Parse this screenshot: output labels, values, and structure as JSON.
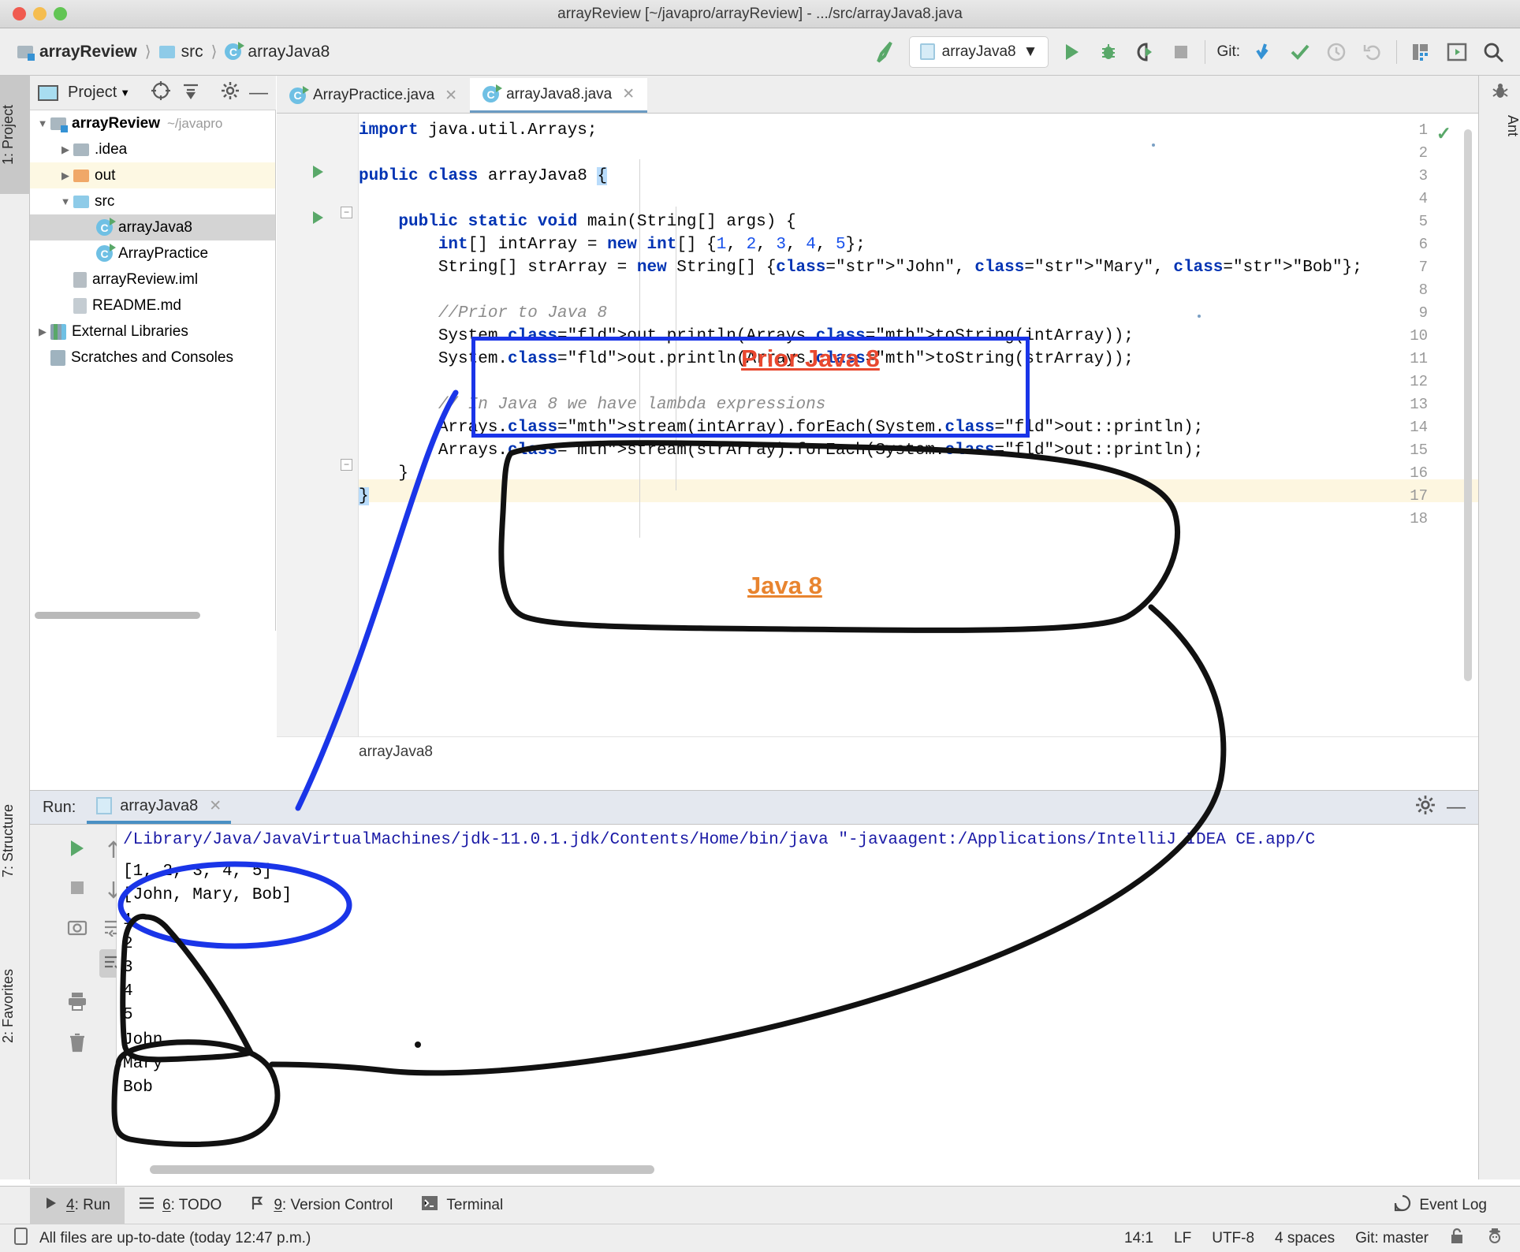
{
  "window": {
    "title": "arrayReview [~/javapro/arrayReview] - .../src/arrayJava8.java"
  },
  "toolbar": {
    "breadcrumbs": [
      {
        "label": "arrayReview",
        "icon": "project-folder-icon"
      },
      {
        "label": "src",
        "icon": "folder-icon"
      },
      {
        "label": "arrayJava8",
        "icon": "java-class-icon"
      }
    ],
    "run_config": "arrayJava8",
    "git_label": "Git:"
  },
  "left_strip": {
    "project_tab": "1: Project",
    "structure_tab": "7: Structure",
    "favorites_tab": "2: Favorites"
  },
  "right_strip": {
    "ant_tab": "Ant"
  },
  "project": {
    "header_label": "Project",
    "tree": [
      {
        "label": "arrayReview",
        "path": "~/javapro",
        "depth": 0,
        "arrow": "down",
        "icon": "project-folder-icon",
        "bold": true,
        "state": "normal"
      },
      {
        "label": ".idea",
        "path": "",
        "depth": 1,
        "arrow": "right",
        "icon": "folder-icon",
        "bold": false,
        "state": "normal"
      },
      {
        "label": "out",
        "path": "",
        "depth": 1,
        "arrow": "right",
        "icon": "folder-orange-icon",
        "bold": false,
        "state": "highlight"
      },
      {
        "label": "src",
        "path": "",
        "depth": 1,
        "arrow": "down",
        "icon": "folder-blue-icon",
        "bold": false,
        "state": "normal"
      },
      {
        "label": "arrayJava8",
        "path": "",
        "depth": 2,
        "arrow": "none",
        "icon": "java-class-icon",
        "bold": false,
        "state": "selected"
      },
      {
        "label": "ArrayPractice",
        "path": "",
        "depth": 2,
        "arrow": "none",
        "icon": "java-class-icon",
        "bold": false,
        "state": "normal"
      },
      {
        "label": "arrayReview.iml",
        "path": "",
        "depth": 1,
        "arrow": "none",
        "icon": "iml-file-icon",
        "bold": false,
        "state": "normal"
      },
      {
        "label": "README.md",
        "path": "",
        "depth": 1,
        "arrow": "none",
        "icon": "markdown-file-icon",
        "bold": false,
        "state": "normal"
      },
      {
        "label": "External Libraries",
        "path": "",
        "depth": 0,
        "arrow": "right",
        "icon": "libraries-icon",
        "bold": false,
        "state": "normal"
      },
      {
        "label": "Scratches and Consoles",
        "path": "",
        "depth": 0,
        "arrow": "none",
        "icon": "scratches-icon",
        "bold": false,
        "state": "normal"
      }
    ]
  },
  "editor": {
    "tabs": [
      {
        "label": "ArrayPractice.java",
        "active": false
      },
      {
        "label": "arrayJava8.java",
        "active": true
      }
    ],
    "breadcrumb": "arrayJava8",
    "line_numbers": [
      "1",
      "2",
      "3",
      "4",
      "5",
      "6",
      "7",
      "8",
      "9",
      "10",
      "11",
      "12",
      "13",
      "14",
      "15",
      "16",
      "17",
      "18"
    ],
    "code_lines": [
      "import java.util.Arrays;",
      "",
      "public class arrayJava8 {",
      "",
      "    public static void main(String[] args) {",
      "        int[] intArray = new int[] {1, 2, 3, 4, 5};",
      "        String[] strArray = new String[] {\"John\", \"Mary\", \"Bob\"};",
      "",
      "        //Prior to Java 8",
      "        System.out.println(Arrays.toString(intArray));",
      "        System.out.println(Arrays.toString(strArray));",
      "",
      "        // In Java 8 we have lambda expressions",
      "        Arrays.stream(intArray).forEach(System.out::println);",
      "        Arrays.stream(strArray).forEach(System.out::println);",
      "    }",
      "}",
      ""
    ]
  },
  "run_panel": {
    "label": "Run:",
    "tab_label": "arrayJava8",
    "console_lines": [
      "/Library/Java/JavaVirtualMachines/jdk-11.0.1.jdk/Contents/Home/bin/java \"-javaagent:/Applications/IntelliJ IDEA CE.app/C",
      "[1, 2, 3, 4, 5]",
      "[John, Mary, Bob]",
      "1",
      "2",
      "3",
      "4",
      "5",
      "John",
      "Mary",
      "Bob"
    ]
  },
  "bottom_bar": {
    "items": [
      {
        "label": "4: Run",
        "mnemonic": "4",
        "icon": "play-icon",
        "selected": true
      },
      {
        "label": "6: TODO",
        "mnemonic": "6",
        "icon": "list-icon",
        "selected": false
      },
      {
        "label": "9: Version Control",
        "mnemonic": "9",
        "icon": "vcs-icon",
        "selected": false
      },
      {
        "label": "Terminal",
        "mnemonic": "",
        "icon": "terminal-icon",
        "selected": false
      }
    ],
    "event_log": "Event Log"
  },
  "status_bar": {
    "message": "All files are up-to-date (today 12:47 p.m.)",
    "caret": "14:1",
    "line_sep": "LF",
    "encoding": "UTF-8",
    "indent": "4 spaces",
    "branch": "Git: master"
  },
  "annotations": {
    "prior_java8_label": "Prior Java 8",
    "java8_label": "Java 8",
    "prior_color": "#e8482f",
    "java8_color": "#e8842f",
    "box_color": "#1a35e8",
    "circle_color": "#1a35e8",
    "pen_color": "#111111"
  }
}
